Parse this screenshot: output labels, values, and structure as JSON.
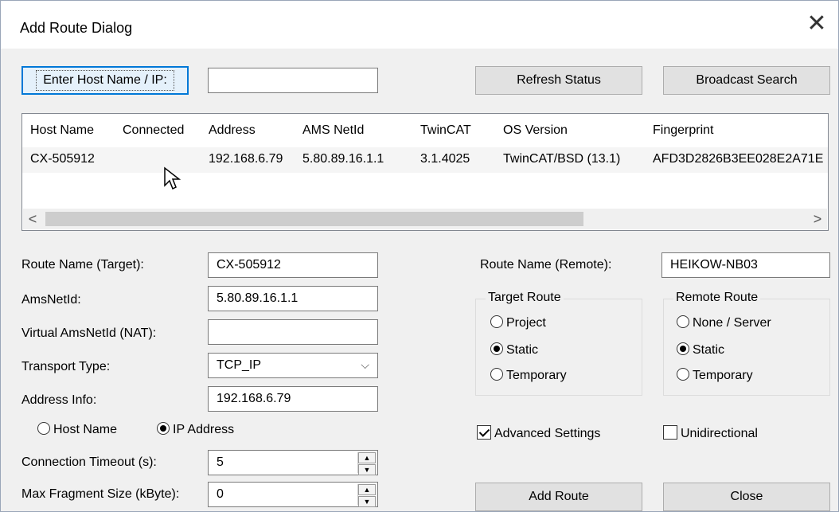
{
  "title": "Add Route Dialog",
  "top": {
    "enter_host_label": "Enter Host Name / IP:",
    "host_input_value": "",
    "refresh_label": "Refresh Status",
    "broadcast_label": "Broadcast Search"
  },
  "list": {
    "columns": [
      "Host Name",
      "Connected",
      "Address",
      "AMS NetId",
      "TwinCAT",
      "OS Version",
      "Fingerprint"
    ],
    "rows": [
      [
        "CX-505912",
        "",
        "192.168.6.79",
        "5.80.89.16.1.1",
        "3.1.4025",
        "TwinCAT/BSD (13.1)",
        "AFD3D2826B3EE028E2A71E"
      ]
    ]
  },
  "form": {
    "route_name_target_label": "Route Name (Target):",
    "route_name_target_value": "CX-505912",
    "amsnetid_label": "AmsNetId:",
    "amsnetid_value": "5.80.89.16.1.1",
    "virtual_amsnetid_label": "Virtual AmsNetId (NAT):",
    "virtual_amsnetid_value": "",
    "transport_type_label": "Transport Type:",
    "transport_type_value": "TCP_IP",
    "address_info_label": "Address Info:",
    "address_info_value": "192.168.6.79",
    "host_name_option": "Host Name",
    "ip_address_option": "IP Address",
    "connection_timeout_label": "Connection Timeout (s):",
    "connection_timeout_value": "5",
    "max_fragment_label": "Max Fragment Size (kByte):",
    "max_fragment_value": "0"
  },
  "right": {
    "route_name_remote_label": "Route Name (Remote):",
    "route_name_remote_value": "HEIKOW-NB03",
    "target_route": {
      "legend": "Target Route",
      "options": [
        "Project",
        "Static",
        "Temporary"
      ],
      "selected": "Static"
    },
    "remote_route": {
      "legend": "Remote Route",
      "options": [
        "None / Server",
        "Static",
        "Temporary"
      ],
      "selected": "Static"
    },
    "advanced_settings_label": "Advanced Settings",
    "advanced_settings_checked": true,
    "unidirectional_label": "Unidirectional",
    "unidirectional_checked": false,
    "add_route_label": "Add Route",
    "close_label": "Close"
  },
  "icons": {
    "close": "close-icon",
    "scroll_left": "chevron-left-icon",
    "scroll_right": "chevron-right-icon",
    "combo": "chevron-down-icon",
    "spin_up": "spin-up-icon",
    "spin_down": "spin-down-icon",
    "cursor": "mouse-pointer-icon"
  },
  "colors": {
    "accent": "#0078d7",
    "background": "#f0f0f0"
  }
}
